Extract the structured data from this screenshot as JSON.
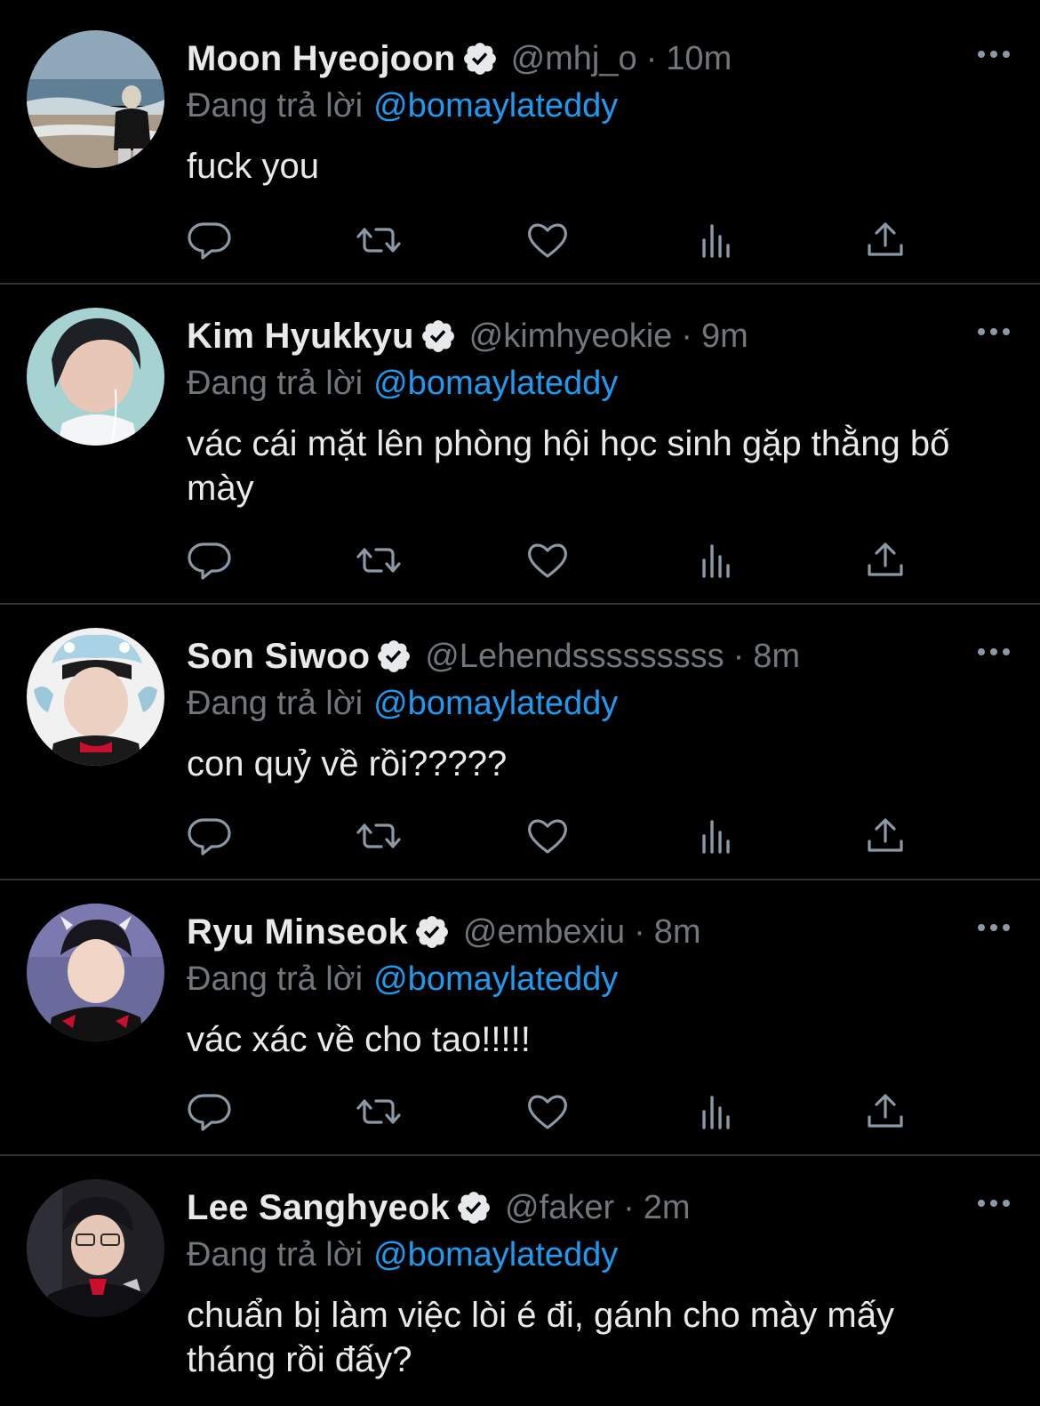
{
  "tweets": [
    {
      "name": "Moon Hyeojoon",
      "handle": "@mhj_o",
      "dot": "·",
      "time": "10m",
      "reply_prefix": "Đang trả lời",
      "reply_to": "@bomaylateddy",
      "text": "fuck you",
      "avatar_theme": "beach"
    },
    {
      "name": "Kim Hyukkyu",
      "handle": "@kimhyeokie",
      "dot": "·",
      "time": "9m",
      "reply_prefix": "Đang trả lời",
      "reply_to": "@bomaylateddy",
      "text": "vác cái mặt lên phòng hội học sinh gặp thằng bố mày",
      "avatar_theme": "teal"
    },
    {
      "name": "Son Siwoo",
      "handle": "@Lehendsssssssss",
      "dot": "·",
      "time": "8m",
      "reply_prefix": "Đang trả lời",
      "reply_to": "@bomaylateddy",
      "text": "con quỷ về rồi?????",
      "avatar_theme": "white"
    },
    {
      "name": "Ryu Minseok",
      "handle": "@embexiu",
      "dot": "·",
      "time": "8m",
      "reply_prefix": "Đang trả lời",
      "reply_to": "@bomaylateddy",
      "text": "vác xác về cho tao!!!!!",
      "avatar_theme": "purple"
    },
    {
      "name": "Lee Sanghyeok",
      "handle": "@faker",
      "dot": "·",
      "time": "2m",
      "reply_prefix": "Đang trả lời",
      "reply_to": "@bomaylateddy",
      "text": "chuẩn bị làm việc lòi é đi, gánh cho mày mấy tháng rồi đấy?",
      "avatar_theme": "dark"
    }
  ],
  "colors": {
    "background": "#000000",
    "text_primary": "#e7e9ea",
    "text_secondary": "#71767b",
    "accent": "#1d9bf0",
    "divider": "#2f3336"
  },
  "icons": {
    "verified": "verified-badge-icon",
    "more": "more-options-icon",
    "reply": "reply-icon",
    "retweet": "retweet-icon",
    "like": "like-heart-icon",
    "views": "views-chart-icon",
    "share": "share-icon"
  }
}
